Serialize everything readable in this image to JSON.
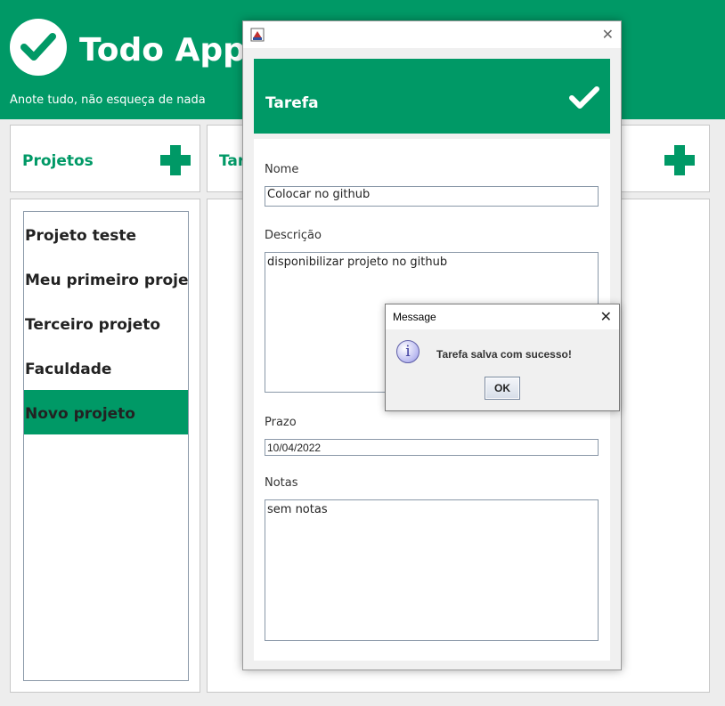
{
  "app": {
    "title": "Todo App",
    "subtitle": "Anote tudo, não esqueça de nada",
    "brand_color": "#009966"
  },
  "projects": {
    "header": "Projetos",
    "items": [
      {
        "label": "Projeto teste",
        "selected": false
      },
      {
        "label": "Meu primeiro projeto",
        "selected": false
      },
      {
        "label": "Terceiro projeto",
        "selected": false
      },
      {
        "label": "Faculdade",
        "selected": false
      },
      {
        "label": "Novo projeto",
        "selected": true
      }
    ]
  },
  "tasks": {
    "header_partial": "Tar"
  },
  "task_dialog": {
    "banner_title": "Tarefa",
    "close_icon": "close-icon",
    "fields": {
      "name_label": "Nome",
      "name_value": "Colocar no github",
      "description_label": "Descrição",
      "description_value": "disponibilizar projeto no github",
      "deadline_label": "Prazo",
      "deadline_value": "10/04/2022",
      "notes_label": "Notas",
      "notes_value": "sem notas"
    }
  },
  "message_box": {
    "title": "Message",
    "text": "Tarefa salva com sucesso!",
    "ok_label": "OK",
    "icon": "info-icon"
  }
}
